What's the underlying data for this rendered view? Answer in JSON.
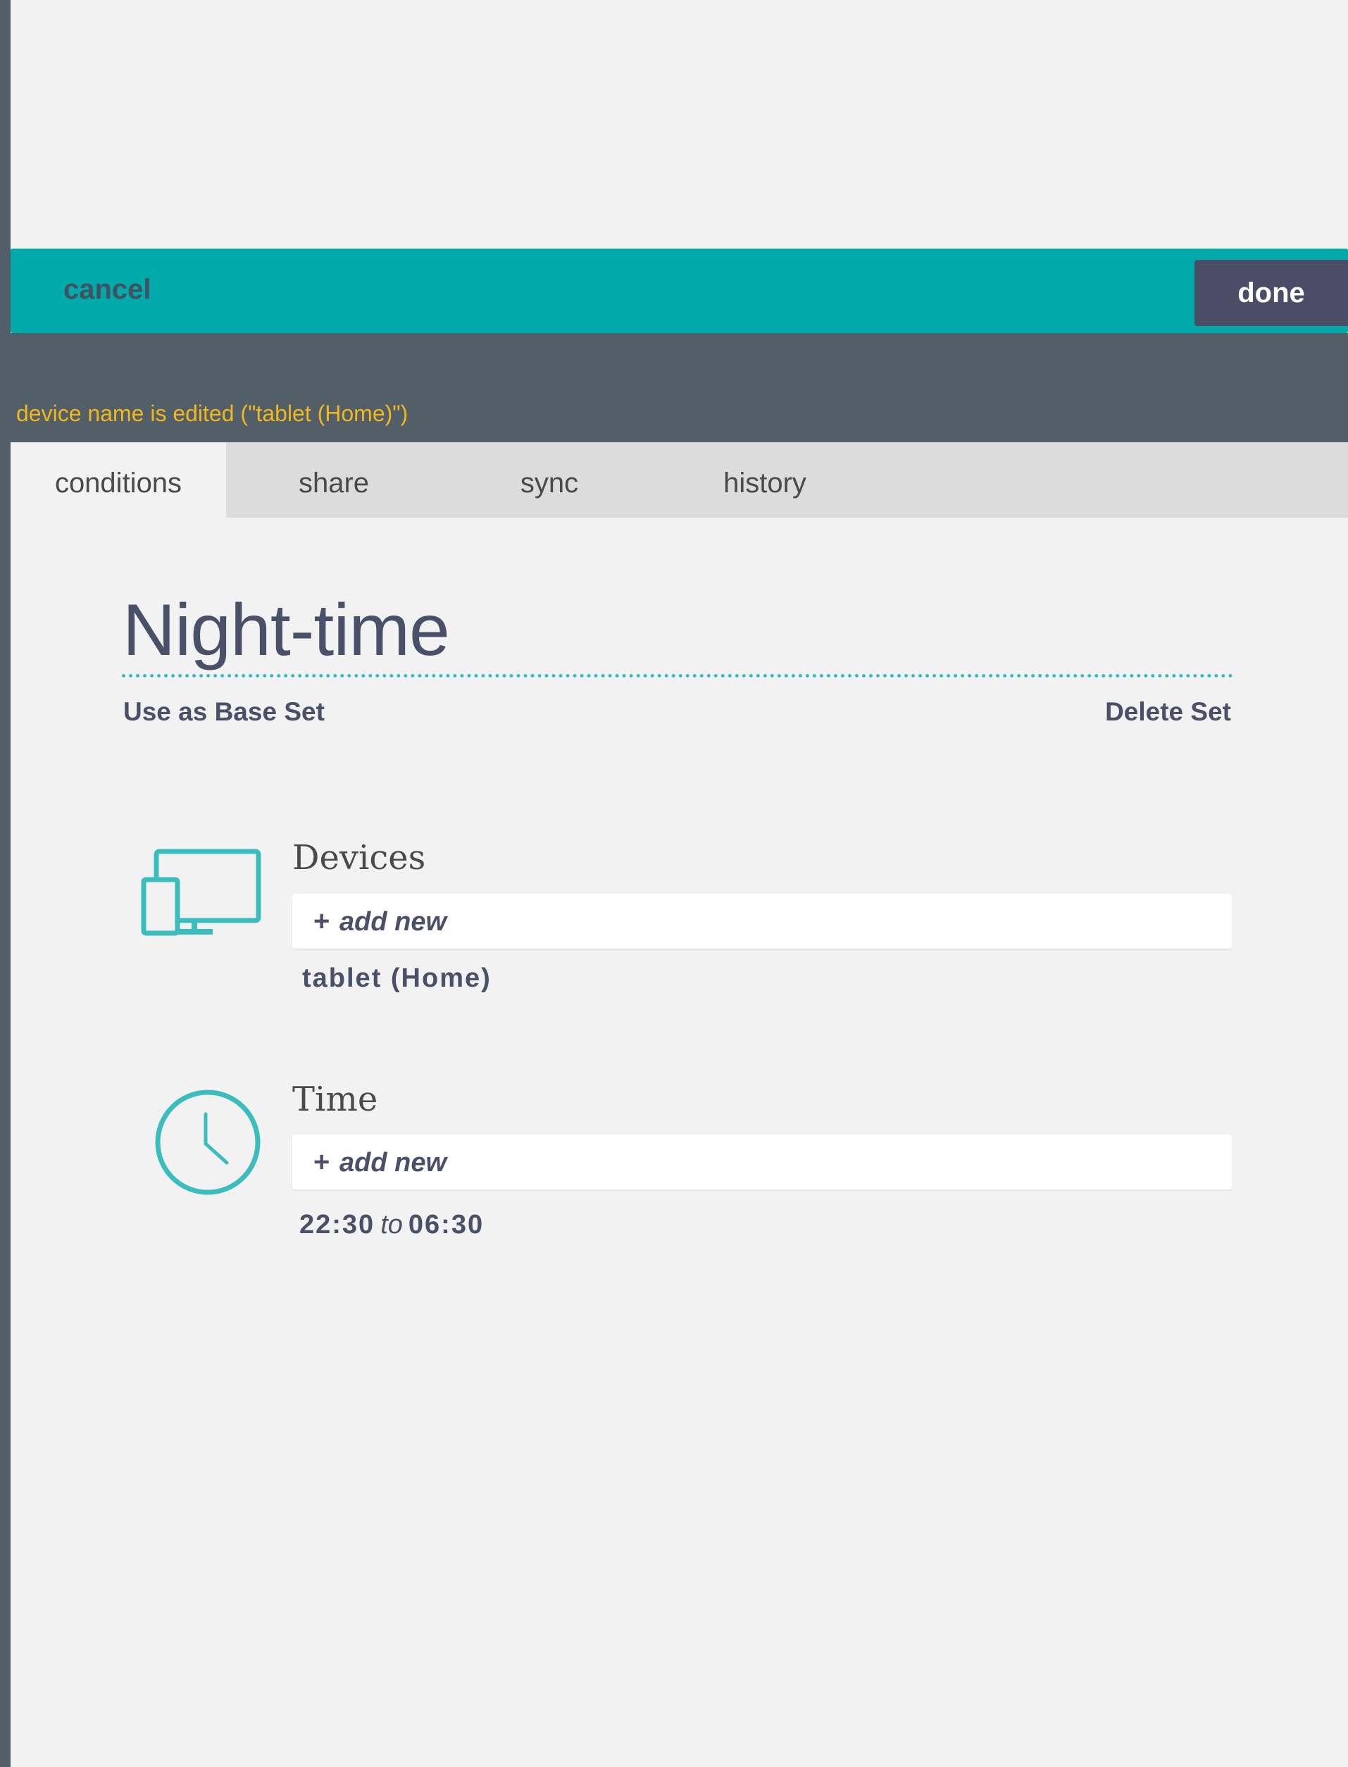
{
  "header": {
    "cancel_label": "cancel",
    "done_label": "done"
  },
  "notice": "device name is edited (\"tablet (Home)\")",
  "tabs": [
    {
      "label": "conditions",
      "active": true
    },
    {
      "label": "share",
      "active": false
    },
    {
      "label": "sync",
      "active": false
    },
    {
      "label": "history",
      "active": false
    }
  ],
  "set": {
    "title": "Night-time",
    "use_as_base_label": "Use as Base Set",
    "delete_label": "Delete Set"
  },
  "sections": {
    "devices": {
      "heading": "Devices",
      "icon": "devices-icon",
      "add_label": "add new",
      "items": [
        "tablet (Home)"
      ]
    },
    "time": {
      "heading": "Time",
      "icon": "clock-icon",
      "add_label": "add new",
      "start": "22:30",
      "connector": "to",
      "end": "06:30"
    }
  },
  "colors": {
    "accent": "#00aaab",
    "icon": "#3cbdbd",
    "dark_panel": "#525f69",
    "done_button": "#4b4d66",
    "notice_text": "#f2b81b",
    "text_dark": "#4a5068"
  }
}
